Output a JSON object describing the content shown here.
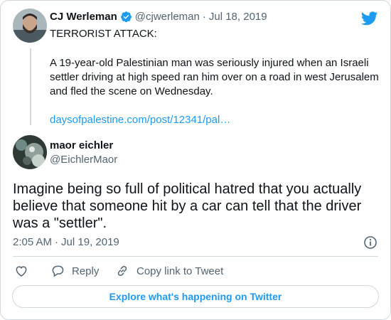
{
  "quoted_tweet": {
    "author_name": "CJ Werleman",
    "handle": "@cjwerleman",
    "separator": "·",
    "date": "Jul 18, 2019",
    "headline": "TERRORIST ATTACK:",
    "body": "A 19-year-old Palestinian man was seriously injured when an Israeli settler driving at high speed ran him over on a road in west Jerusalem and fled the scene on Wednesday.",
    "link": "daysofpalestine.com/post/12341/pal…"
  },
  "reply_tweet": {
    "author_name": "maor eichler",
    "handle": "@EichlerMaor",
    "text": "Imagine being so full of political hatred that you actually believe that someone hit by a car can tell that the driver was a \"settler\".",
    "time": "2:05 AM",
    "separator": "·",
    "date": "Jul 19, 2019"
  },
  "actions": {
    "reply_label": "Reply",
    "copy_label": "Copy link to Tweet"
  },
  "explore_label": "Explore what's happening on Twitter",
  "colors": {
    "twitter_blue": "#1d9bf0",
    "muted_gray": "#536471",
    "border": "#cfd9de"
  },
  "icons": [
    "twitter-bird-icon",
    "verified-badge-icon",
    "info-icon",
    "heart-icon",
    "reply-icon",
    "link-icon"
  ]
}
